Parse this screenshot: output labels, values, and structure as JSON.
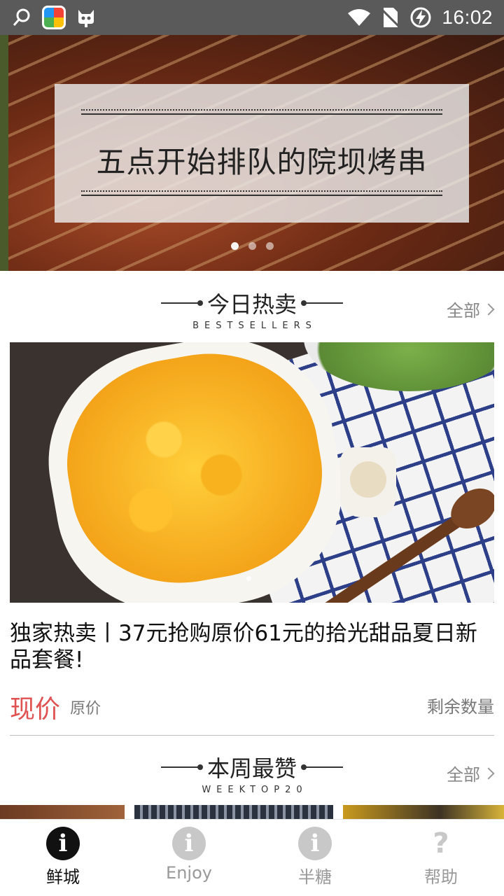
{
  "status_bar": {
    "time": "16:02",
    "icons_left": [
      "search-notification-icon",
      "app-store-icon",
      "bot-icon"
    ],
    "icons_right": [
      "wifi-icon",
      "no-sim-icon",
      "charging-icon"
    ]
  },
  "banner": {
    "title": "五点开始排队的院坝烤串",
    "page_count": 3,
    "active_page": 1
  },
  "section_bestsellers": {
    "title": "今日热卖",
    "subtitle": "BESTSELLERS",
    "all_label": "全部"
  },
  "product": {
    "title": "独家热卖丨37元抢购原价61元的拾光甜品夏日新品套餐!",
    "price_now_label": "现价",
    "price_orig_label": "原价",
    "remaining_label": "剩余数量"
  },
  "section_weektop": {
    "title": "本周最赞",
    "subtitle": "WEEKTOP20",
    "all_label": "全部"
  },
  "bottom_nav": {
    "items": [
      {
        "label": "鲜城",
        "icon": "info-icon",
        "active": true
      },
      {
        "label": "Enjoy",
        "icon": "info-icon",
        "active": false
      },
      {
        "label": "半糖",
        "icon": "info-icon",
        "active": false
      },
      {
        "label": "帮助",
        "icon": "question-icon",
        "active": false
      }
    ]
  },
  "colors": {
    "status_bar": "#5a5a5a",
    "price_accent": "#e05252",
    "nav_active": "#111111",
    "nav_inactive": "#c8c8c8"
  }
}
